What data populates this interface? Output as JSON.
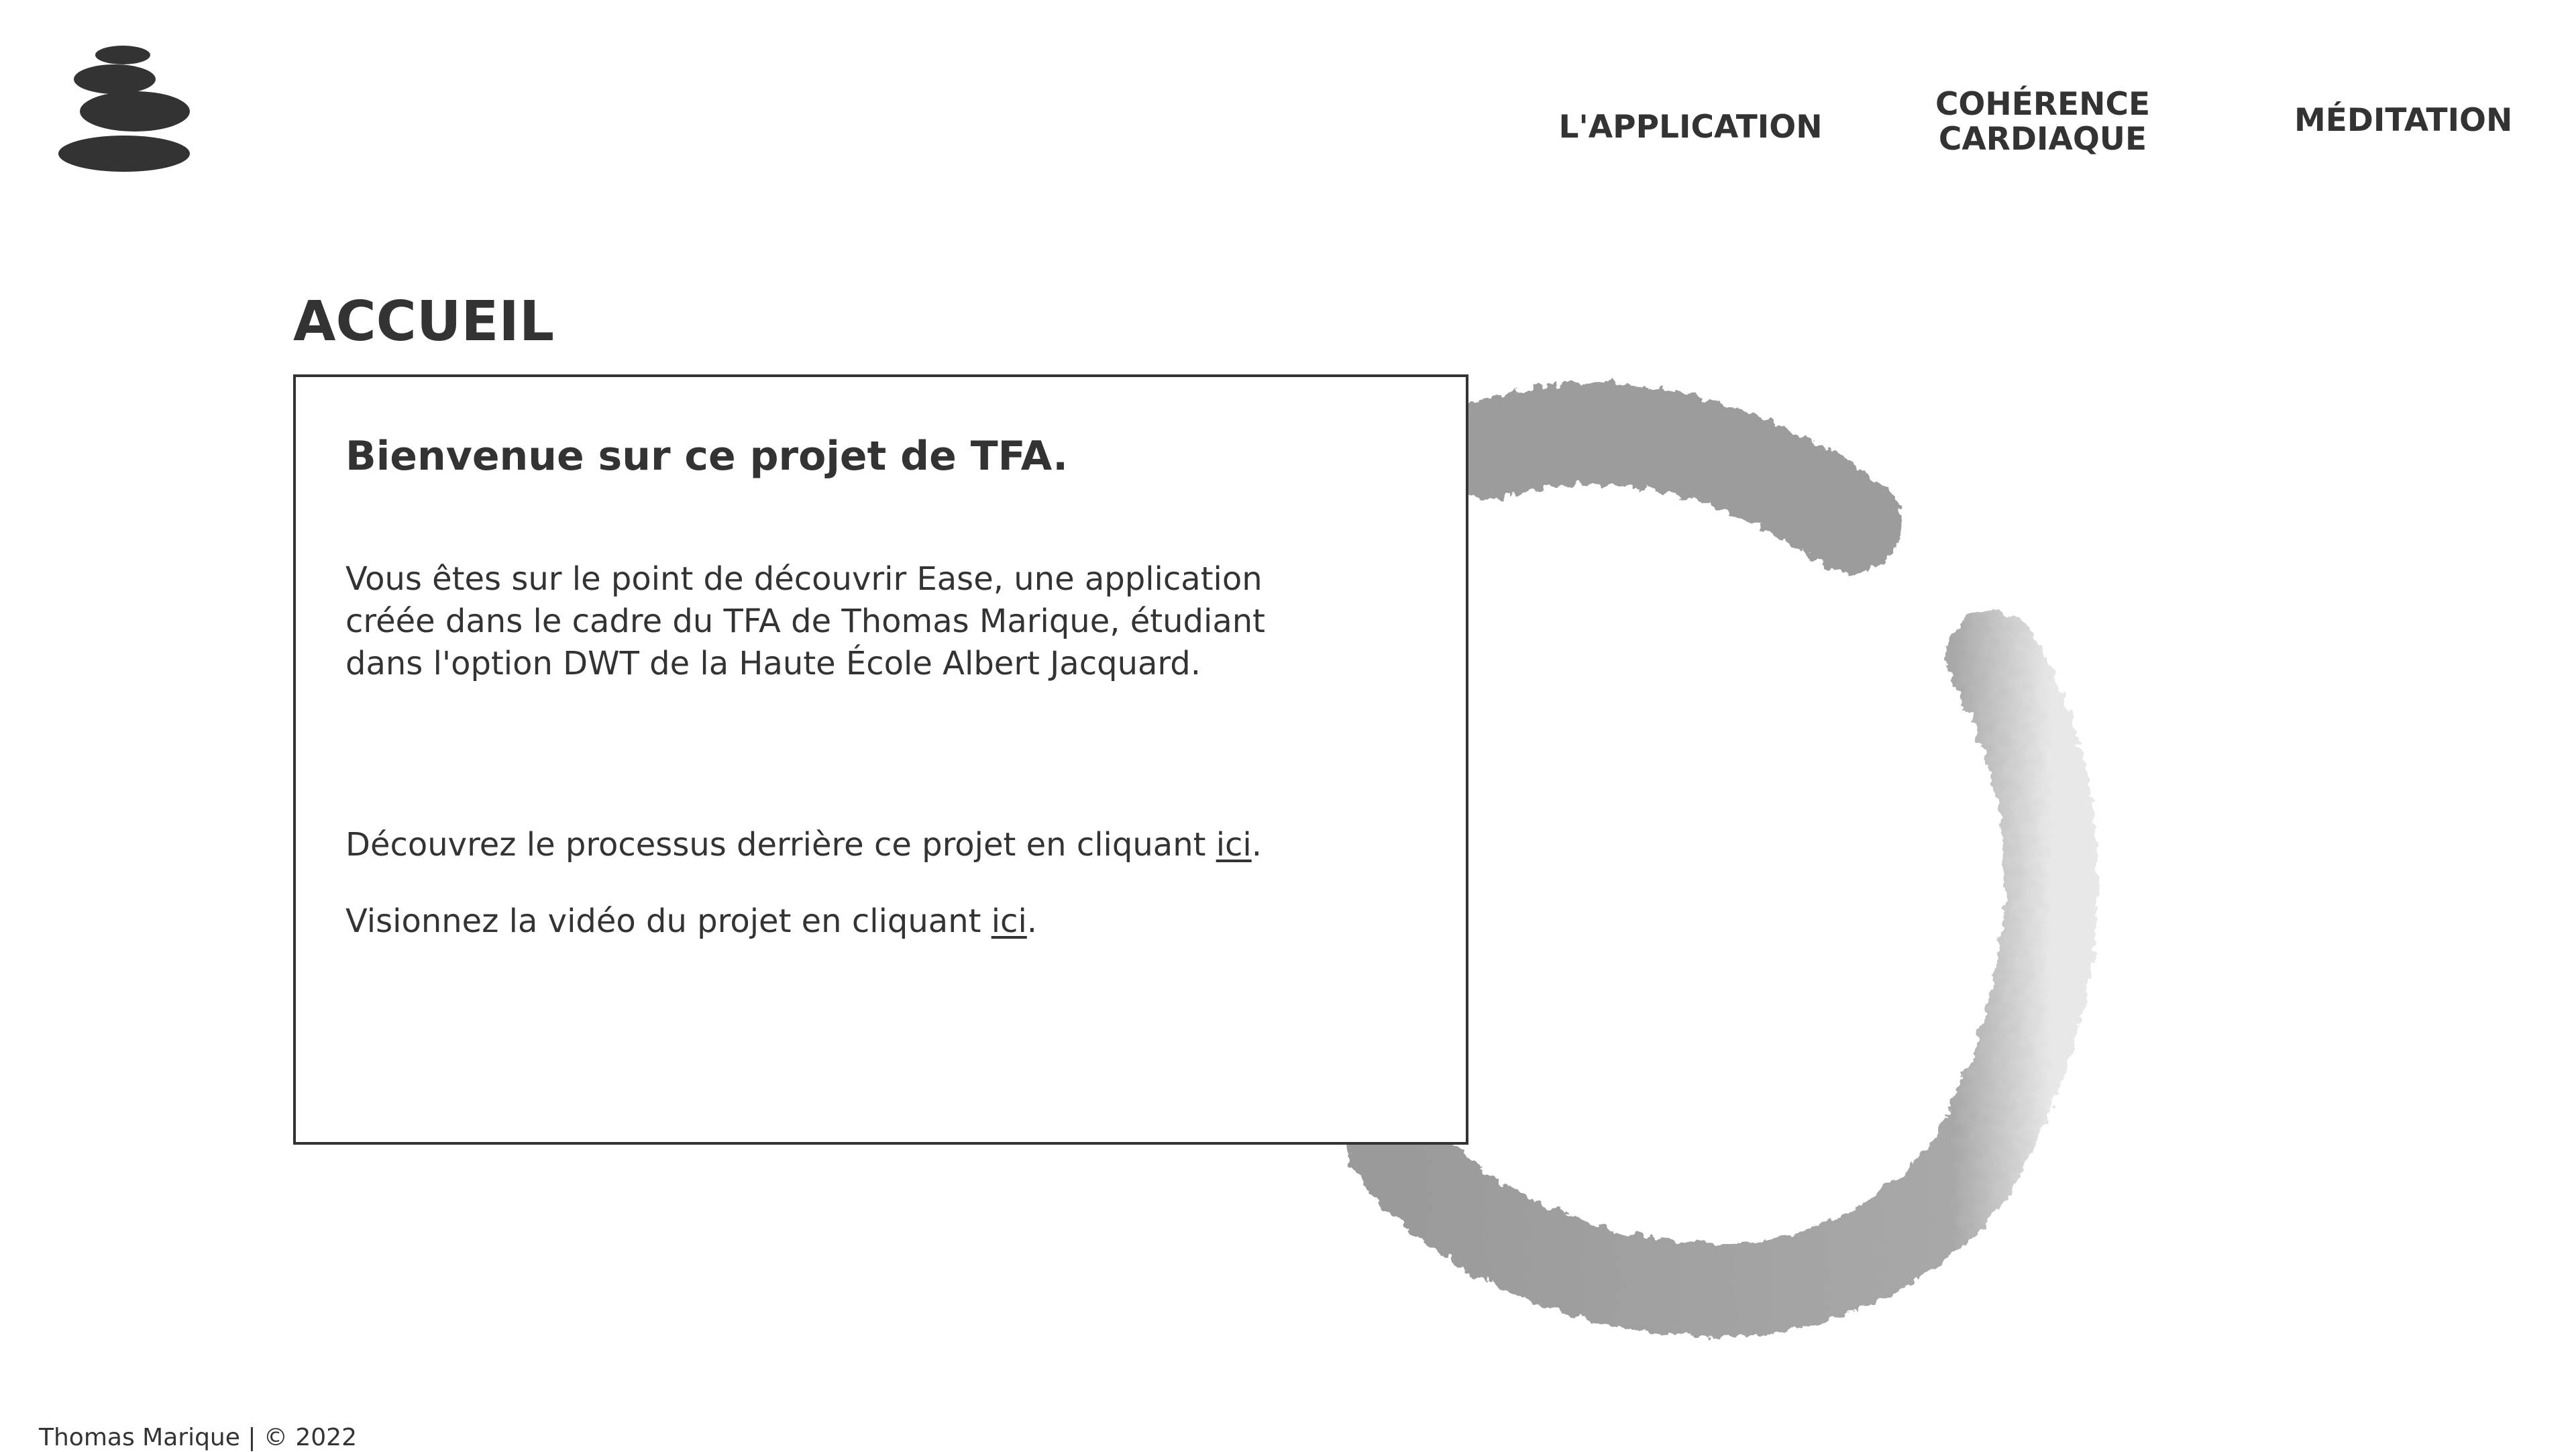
{
  "nav": {
    "logo_icon": "balanced-stones-logo",
    "items": [
      {
        "label": "L'APPLICATION"
      },
      {
        "label": "COHÉRENCE CARDIAQUE"
      },
      {
        "label": "MÉDITATION"
      }
    ]
  },
  "main": {
    "title": "ACCUEIL",
    "card": {
      "heading": "Bienvenue sur ce projet de TFA.",
      "intro": "Vous êtes sur le point de découvrir Ease, une application créée dans le cadre du TFA de Thomas Marique, étudiant dans l'option DWT de la Haute École Albert Jacquard.",
      "process_text": "Découvrez le processus derrière ce projet en cliquant ",
      "video_text": "Visionnez la vidéo du projet en cliquant ",
      "link_label": "ici",
      "period": "."
    },
    "decoration": "grey-brush-circle"
  },
  "footer": {
    "text": "Thomas Marique | © 2022"
  },
  "colors": {
    "text": "#333333",
    "background": "#ffffff",
    "ring": "#a0a0a0"
  }
}
